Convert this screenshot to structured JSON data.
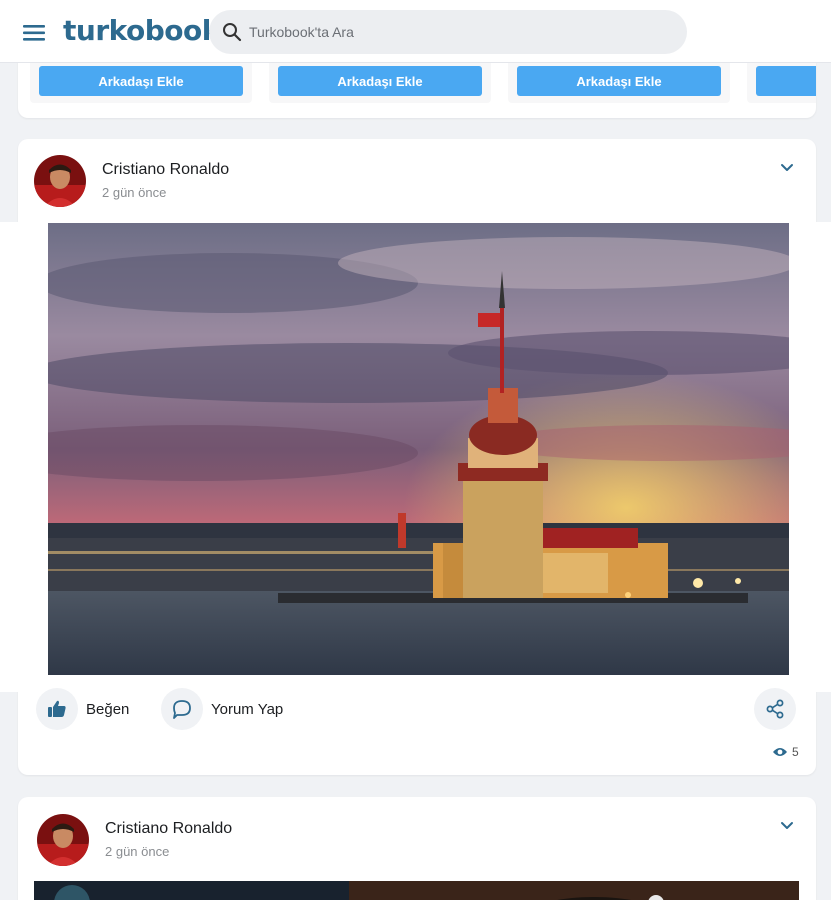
{
  "header": {
    "logo": "turkobook",
    "search_placeholder": "Turkobook'ta Ara"
  },
  "suggestions": {
    "add_friend_label": "Arkadaşı Ekle"
  },
  "posts": [
    {
      "author": "Cristiano Ronaldo",
      "time": "2 gün önce",
      "like_label": "Beğen",
      "comment_label": "Yorum Yap",
      "views": "5"
    },
    {
      "author": "Cristiano Ronaldo",
      "time": "2 gün önce"
    }
  ],
  "colors": {
    "brand": "#2d6a8f",
    "button_blue": "#4aa8f2",
    "background": "#f0f2f5"
  }
}
